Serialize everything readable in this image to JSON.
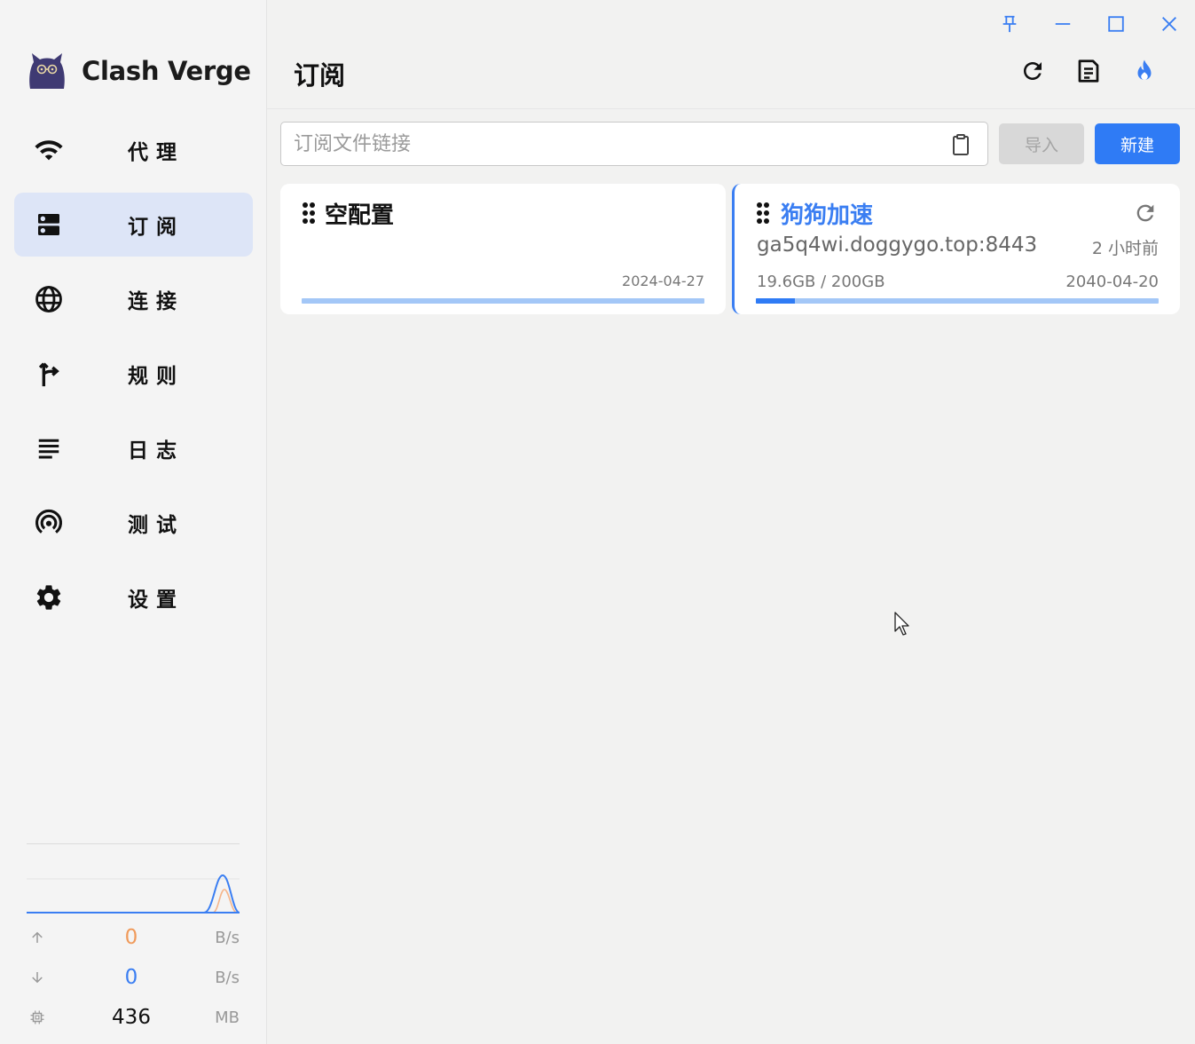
{
  "app": {
    "name": "Clash Verge"
  },
  "sidebar": {
    "items": [
      {
        "label": "代理",
        "icon": "wifi-icon"
      },
      {
        "label": "订阅",
        "icon": "dns-icon",
        "active": true
      },
      {
        "label": "连接",
        "icon": "globe-icon"
      },
      {
        "label": "规则",
        "icon": "fork-arrow-icon"
      },
      {
        "label": "日志",
        "icon": "lines-icon"
      },
      {
        "label": "测试",
        "icon": "radar-icon"
      },
      {
        "label": "设置",
        "icon": "gear-icon"
      }
    ]
  },
  "traffic": {
    "upload_value": "0",
    "upload_unit": "B/s",
    "download_value": "0",
    "download_unit": "B/s",
    "memory_value": "436",
    "memory_unit": "MB",
    "colors": {
      "upload": "#f09a5a",
      "download": "#3a7ef2"
    }
  },
  "header": {
    "title": "订阅"
  },
  "toolbar": {
    "url_placeholder": "订阅文件链接",
    "import_label": "导入",
    "new_label": "新建"
  },
  "profiles": [
    {
      "title": "空配置",
      "date": "2024-04-27",
      "usage_fraction": 0
    },
    {
      "title": "狗狗加速",
      "host": "ga5q4wi.doggygo.top:8443",
      "updated": "2 小时前",
      "usage": "19.6GB / 200GB",
      "date": "2040-04-20",
      "usage_fraction": 0.098,
      "selected": true
    }
  ],
  "colors": {
    "accent": "#2f7bf5",
    "active_nav": "#dde5f7"
  }
}
